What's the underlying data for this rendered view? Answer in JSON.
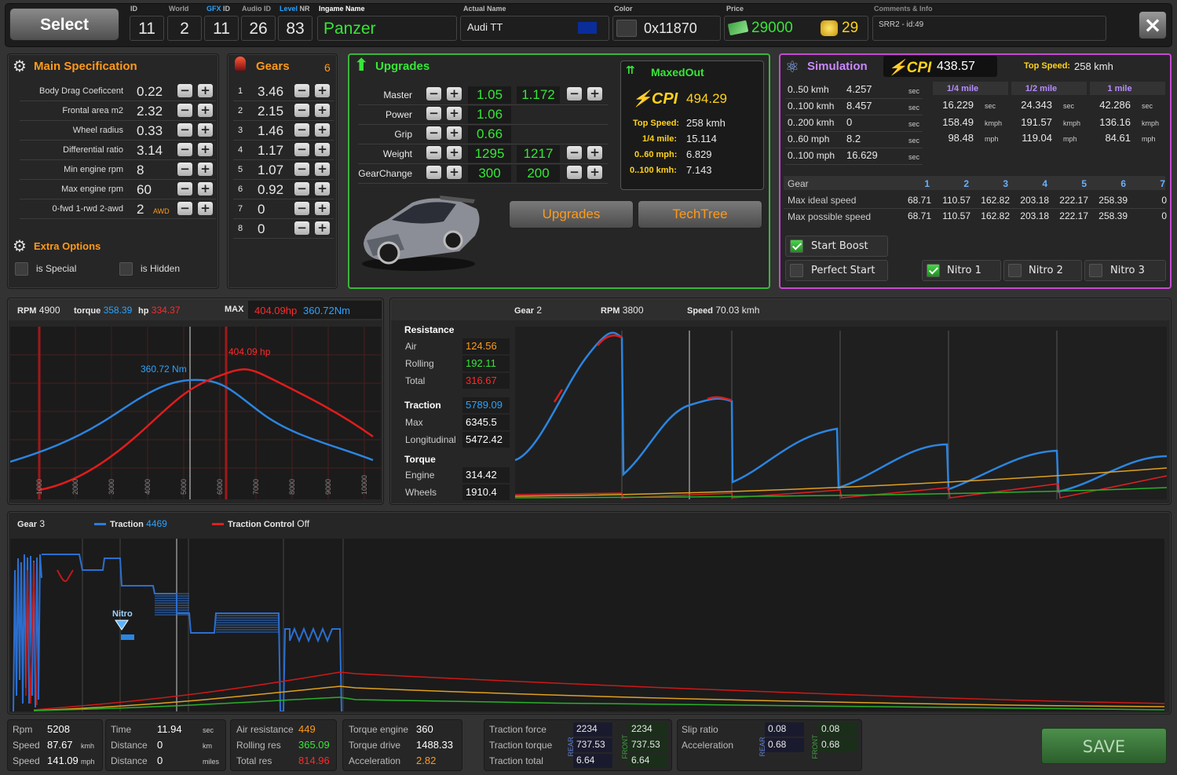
{
  "top": {
    "select": "Select",
    "id_l": "ID",
    "id": "11",
    "world_l": "World",
    "world": "2",
    "gfx_l": "GFX",
    "gfx_l2": "ID",
    "gfx": "11",
    "audio_l": "Audio ID",
    "audio": "26",
    "level_l": "Level",
    "level_l2": "NR",
    "level": "83",
    "ingame_l": "Ingame Name",
    "ingame": "Panzer",
    "actual_l": "Actual Name",
    "actual": "Audi TT",
    "color_l": "Color",
    "color": "0x11870",
    "price_l": "Price",
    "price_money": "29000",
    "price_gold": "29",
    "comments_l": "Comments & Info",
    "comments": "SRR2 - id:49",
    "close": "×"
  },
  "spec": {
    "title": "Main Specification",
    "rows": [
      {
        "l": "Body Drag Coeficcent",
        "v": "0.22"
      },
      {
        "l": "Frontal area m2",
        "v": "2.32"
      },
      {
        "l": "Wheel radius",
        "v": "0.33"
      },
      {
        "l": "Differential ratio",
        "v": "3.14"
      },
      {
        "l": "Min engine rpm",
        "v": "8"
      },
      {
        "l": "Max engine rpm",
        "v": "60"
      },
      {
        "l": "0-fwd 1-rwd 2-awd",
        "v": "2",
        "extra": "AWD"
      }
    ],
    "extra_title": "Extra Options",
    "special": "is Special",
    "hidden": "is Hidden"
  },
  "gears": {
    "title": "Gears",
    "count": "6",
    "rows": [
      {
        "n": "1",
        "v": "3.46"
      },
      {
        "n": "2",
        "v": "2.15"
      },
      {
        "n": "3",
        "v": "1.46"
      },
      {
        "n": "4",
        "v": "1.17"
      },
      {
        "n": "5",
        "v": "1.07"
      },
      {
        "n": "6",
        "v": "0.92"
      },
      {
        "n": "7",
        "v": "0"
      },
      {
        "n": "8",
        "v": "0"
      }
    ]
  },
  "upgrades": {
    "title": "Upgrades",
    "rows": [
      {
        "l": "Master",
        "a": "1.05",
        "b": "1.172"
      },
      {
        "l": "Power",
        "a": "1.06"
      },
      {
        "l": "Grip",
        "a": "0.66"
      },
      {
        "l": "Weight",
        "a": "1295",
        "b": "1217"
      },
      {
        "l": "GearChange",
        "a": "300",
        "b": "200"
      }
    ],
    "btn1": "Upgrades",
    "btn2": "TechTree",
    "maxed": {
      "title": "MaxedOut",
      "cpi": "494.29",
      "ts_l": "Top Speed:",
      "ts": "258 kmh",
      "qm_l": "1/4 mile:",
      "qm": "15.114",
      "m60_l": "0..60 mph:",
      "m60": "6.829",
      "k100_l": "0..100 kmh:",
      "k100": "7.143"
    }
  },
  "sim": {
    "title": "Simulation",
    "cpi": "438.57",
    "ts_l": "Top Speed:",
    "ts": "258 kmh",
    "accel": [
      {
        "l": "0..50 kmh",
        "v": "4.257",
        "u": "sec"
      },
      {
        "l": "0..100 kmh",
        "v": "8.457",
        "u": "sec"
      },
      {
        "l": "0..200 kmh",
        "v": "0",
        "u": "sec"
      },
      {
        "l": "0..60 mph",
        "v": "8.2",
        "u": "sec"
      },
      {
        "l": "0..100 mph",
        "v": "16.629",
        "u": "sec"
      }
    ],
    "miles": [
      {
        "h": "1/4 mile",
        "t": "16.229",
        "s": "158.49",
        "m": "98.48"
      },
      {
        "h": "1/2 mile",
        "t": "24.343",
        "s": "191.57",
        "m": "119.04"
      },
      {
        "h": "1 mile",
        "t": "42.286",
        "s": "136.16",
        "m": "84.61"
      }
    ],
    "u_sec": "sec",
    "u_kmph": "kmph",
    "u_mph": "mph",
    "gear_l": "Gear",
    "gears": [
      "1",
      "2",
      "3",
      "4",
      "5",
      "6",
      "7"
    ],
    "ideal_l": "Max ideal speed",
    "ideal": [
      "68.71",
      "110.57",
      "162.82",
      "203.18",
      "222.17",
      "258.39",
      "0"
    ],
    "poss_l": "Max possible speed",
    "poss": [
      "68.71",
      "110.57",
      "162.82",
      "203.18",
      "222.17",
      "258.39",
      "0"
    ],
    "boost": "Start Boost",
    "perfect": "Perfect Start",
    "n1": "Nitro 1",
    "n2": "Nitro 2",
    "n3": "Nitro 3"
  },
  "engine": {
    "rpm_l": "RPM",
    "rpm": "4900",
    "tq_l": "torque",
    "tq": "358.39",
    "hp_l": "hp",
    "hp": "334.37",
    "max_l": "MAX",
    "maxhp": "404.09hp",
    "maxnm": "360.72Nm",
    "lab_nm": "360.72 Nm",
    "lab_hp": "404.09 hp",
    "ticks": [
      "1000",
      "2000",
      "3000",
      "4000",
      "5000",
      "6000",
      "7000",
      "8000",
      "9000",
      "10000"
    ]
  },
  "gear2": {
    "gear_l": "Gear",
    "gear": "2",
    "rpm_l": "RPM",
    "rpm": "3800",
    "speed_l": "Speed",
    "speed": "70.03 kmh",
    "res_t": "Resistance",
    "air_l": "Air",
    "air": "124.56",
    "roll_l": "Rolling",
    "roll": "192.11",
    "tot_l": "Total",
    "tot": "316.67",
    "tr_t": "Traction",
    "tr": "5789.09",
    "max_l": "Max",
    "max": "6345.5",
    "long_l": "Longitudinal",
    "long": "5472.42",
    "tq_t": "Torque",
    "eng_l": "Engine",
    "eng": "314.42",
    "wh_l": "Wheels",
    "wh": "1910.4"
  },
  "race": {
    "gear_l": "Gear",
    "gear": "3",
    "tr_l": "Traction",
    "tr": "4469",
    "tc_l": "Traction Control",
    "tc": "Off",
    "nitro": "Nitro"
  },
  "bottom": {
    "rpm_l": "Rpm",
    "rpm": "5208",
    "sp_l": "Speed",
    "sp_k": "87.67",
    "u_k": "kmh",
    "sp_m": "141.09",
    "u_m": "mph",
    "time_l": "Time",
    "time": "11.94",
    "u_s": "sec",
    "dist_l": "Distance",
    "dist_k": "0",
    "u_km": "km",
    "dist_m": "0",
    "u_mi": "miles",
    "air_l": "Air resistance",
    "air": "449",
    "roll_l": "Rolling res",
    "roll": "365.09",
    "tot_l": "Total res",
    "tot": "814.96",
    "te_l": "Torque engine",
    "te": "360",
    "td_l": "Torque drive",
    "td": "1488.33",
    "acc_l": "Acceleration",
    "acc": "2.82",
    "tf_l": "Traction force",
    "tf_r": "2234",
    "tf_f": "2234",
    "tt_l": "Traction torque",
    "tt_r": "737.53",
    "tt_f": "737.53",
    "ttot_l": "Traction total",
    "ttot_r": "6.64",
    "ttot_f": "6.64",
    "rear": "REAR",
    "front": "FRONT",
    "slip_l": "Slip ratio",
    "slip_r": "0.08",
    "slip_f": "0.08",
    "accel_l": "Acceleration",
    "acc_r": "0.68",
    "acc_f": "0.68",
    "save": "SAVE"
  }
}
